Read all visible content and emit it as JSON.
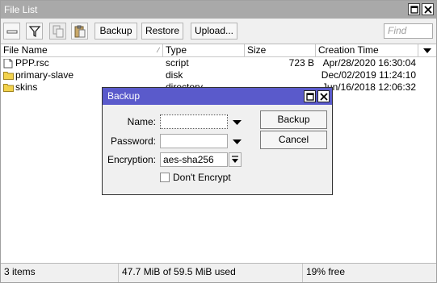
{
  "window": {
    "title": "File List"
  },
  "toolbar": {
    "remove_icon": "minus-icon",
    "filter_icon": "filter-icon",
    "copy_icon": "copy-icon",
    "paste_icon": "paste-icon",
    "backup_label": "Backup",
    "restore_label": "Restore",
    "upload_label": "Upload...",
    "find_placeholder": "Find"
  },
  "table": {
    "columns": [
      "File Name",
      "Type",
      "Size",
      "Creation Time"
    ],
    "rows": [
      {
        "name": "PPP.rsc",
        "type": "script",
        "size": "723 B",
        "created": "Apr/28/2020 16:30:04",
        "icon": "file-icon"
      },
      {
        "name": "primary-slave",
        "type": "disk",
        "size": "",
        "created": "Dec/02/2019 11:24:10",
        "icon": "folder-icon"
      },
      {
        "name": "skins",
        "type": "directory",
        "size": "",
        "created": "Jun/16/2018 12:06:32",
        "icon": "folder-icon"
      }
    ]
  },
  "status": {
    "items": "3 items",
    "usage": "47.7 MiB of 59.5 MiB used",
    "free": "19% free"
  },
  "dialog": {
    "title": "Backup",
    "name_label": "Name:",
    "name_value": "",
    "password_label": "Password:",
    "password_value": "",
    "encryption_label": "Encryption:",
    "encryption_value": "aes-sha256",
    "dont_encrypt_label": "Don't Encrypt",
    "dont_encrypt_checked": false,
    "backup_button": "Backup",
    "cancel_button": "Cancel"
  },
  "colors": {
    "titlebar": "#a9a9a9",
    "dialog_titlebar": "#5a5acb",
    "folder": "#f2d24c"
  }
}
